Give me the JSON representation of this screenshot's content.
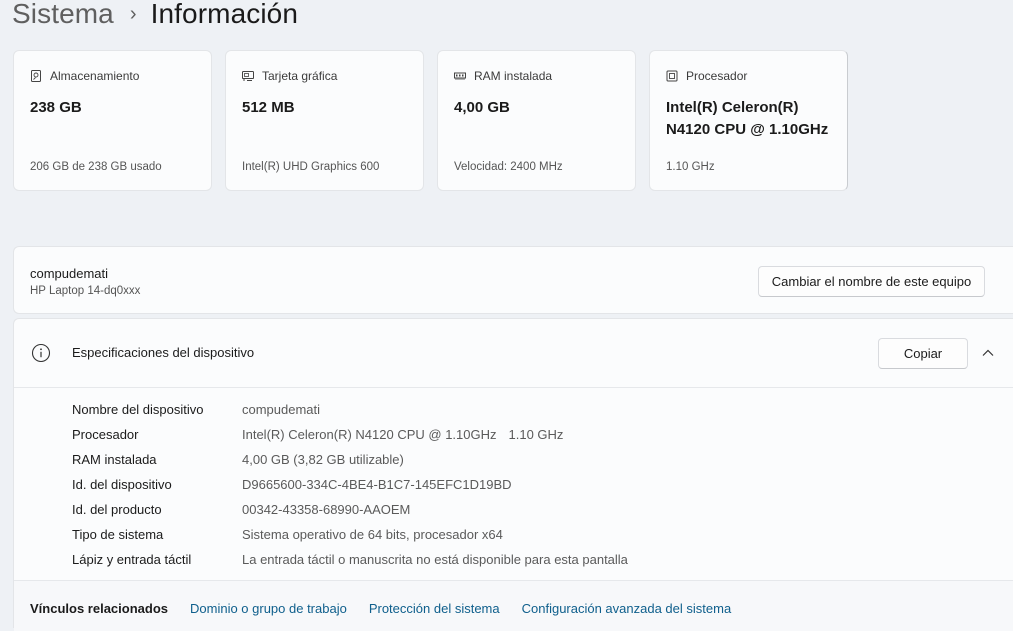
{
  "breadcrumb": {
    "parent": "Sistema",
    "separator": "›",
    "current": "Información"
  },
  "cards": [
    {
      "icon": "storage-icon",
      "title": "Almacenamiento",
      "value": "238 GB",
      "sub": "206 GB de 238 GB usado"
    },
    {
      "icon": "graphics-card-icon",
      "title": "Tarjeta gráfica",
      "value": "512 MB",
      "sub": "Intel(R) UHD Graphics 600"
    },
    {
      "icon": "ram-icon",
      "title": "RAM instalada",
      "value": "4,00 GB",
      "sub": "Velocidad: 2400 MHz"
    },
    {
      "icon": "processor-icon",
      "title": "Procesador",
      "value": "Intel(R) Celeron(R) N4120 CPU @ 1.10GHz",
      "sub": "1.10 GHz"
    }
  ],
  "device": {
    "name": "compudemati",
    "model": "HP Laptop 14-dq0xxx",
    "rename_button": "Cambiar el nombre de este equipo"
  },
  "specs": {
    "title": "Especificaciones del dispositivo",
    "copy_button": "Copiar",
    "rows": [
      {
        "label": "Nombre del dispositivo",
        "value": "compudemati"
      },
      {
        "label": "Procesador",
        "value": "Intel(R) Celeron(R) N4120 CPU @ 1.10GHz",
        "value2": "1.10 GHz"
      },
      {
        "label": "RAM instalada",
        "value": "4,00 GB (3,82 GB utilizable)"
      },
      {
        "label": "Id. del dispositivo",
        "value": "D9665600-334C-4BE4-B1C7-145EFC1D19BD"
      },
      {
        "label": "Id. del producto",
        "value": "00342-43358-68990-AAOEM"
      },
      {
        "label": "Tipo de sistema",
        "value": "Sistema operativo de 64 bits, procesador x64"
      },
      {
        "label": "Lápiz y entrada táctil",
        "value": "La entrada táctil o manuscrita no está disponible para esta pantalla"
      }
    ]
  },
  "related": {
    "label": "Vínculos relacionados",
    "links": [
      "Dominio o grupo de trabajo",
      "Protección del sistema",
      "Configuración avanzada del sistema"
    ]
  },
  "colors": {
    "background": "#eef1f5",
    "card": "#fbfcfd",
    "link": "#0f5f8c"
  }
}
